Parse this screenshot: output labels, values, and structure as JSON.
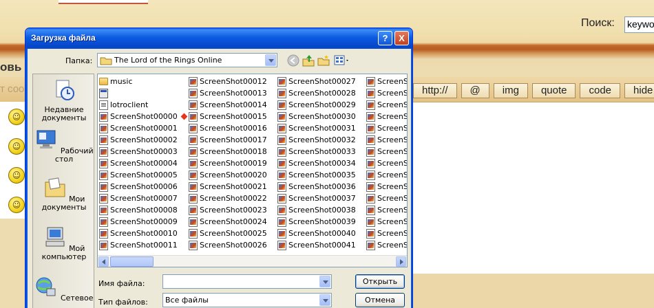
{
  "background": {
    "search_label": "Поиск:",
    "search_value": "keywo",
    "heading_fragment": "овь",
    "faded_text": "т соо",
    "bbcode_buttons": [
      "http://",
      "@",
      "img",
      "quote",
      "code",
      "hide"
    ],
    "smileys": [
      "smile-icon",
      "wink-icon",
      "happy-icon",
      "confused-icon"
    ]
  },
  "dialog": {
    "title": "Загрузка файла",
    "help_symbol": "?",
    "close_symbol": "X",
    "folder_label": "Папка:",
    "folder_value": "The Lord of the Rings Online",
    "places": [
      {
        "label": "Недавние документы",
        "icon": "recent-documents-icon"
      },
      {
        "label": "Рабочий стол",
        "icon": "desktop-icon"
      },
      {
        "label": "Мои документы",
        "icon": "my-documents-icon"
      },
      {
        "label": "Мой компьютер",
        "icon": "my-computer-icon"
      },
      {
        "label": "Сетевое",
        "icon": "network-icon"
      }
    ],
    "files": {
      "col1": [
        {
          "name": "music",
          "type": "folder"
        },
        {
          "name": "",
          "type": "app"
        },
        {
          "name": "lotroclient",
          "type": "doc"
        },
        {
          "name": "ScreenShot00000",
          "type": "img",
          "marker": true
        },
        {
          "name": "ScreenShot00001",
          "type": "img"
        },
        {
          "name": "ScreenShot00002",
          "type": "img"
        },
        {
          "name": "ScreenShot00003",
          "type": "img"
        },
        {
          "name": "ScreenShot00004",
          "type": "img"
        },
        {
          "name": "ScreenShot00005",
          "type": "img"
        },
        {
          "name": "ScreenShot00006",
          "type": "img"
        },
        {
          "name": "ScreenShot00007",
          "type": "img"
        },
        {
          "name": "ScreenShot00008",
          "type": "img"
        },
        {
          "name": "ScreenShot00009",
          "type": "img"
        },
        {
          "name": "ScreenShot00010",
          "type": "img"
        },
        {
          "name": "ScreenShot00011",
          "type": "img"
        }
      ],
      "col2": [
        "ScreenShot00012",
        "ScreenShot00013",
        "ScreenShot00014",
        "ScreenShot00015",
        "ScreenShot00016",
        "ScreenShot00017",
        "ScreenShot00018",
        "ScreenShot00019",
        "ScreenShot00020",
        "ScreenShot00021",
        "ScreenShot00022",
        "ScreenShot00023",
        "ScreenShot00024",
        "ScreenShot00025",
        "ScreenShot00026"
      ],
      "col3": [
        "ScreenShot00027",
        "ScreenShot00028",
        "ScreenShot00029",
        "ScreenShot00030",
        "ScreenShot00031",
        "ScreenShot00032",
        "ScreenShot00033",
        "ScreenShot00034",
        "ScreenShot00035",
        "ScreenShot00036",
        "ScreenShot00037",
        "ScreenShot00038",
        "ScreenShot00039",
        "ScreenShot00040",
        "ScreenShot00041"
      ],
      "col4": [
        "ScreenSh",
        "ScreenSh",
        "ScreenSh",
        "ScreenSh",
        "ScreenSh",
        "ScreenSh",
        "ScreenSh",
        "ScreenSh",
        "ScreenSh",
        "ScreenSh",
        "ScreenSh",
        "ScreenSh",
        "ScreenSh",
        "ScreenSh",
        "ScreenSh"
      ]
    },
    "filename_label": "Имя файла:",
    "filename_value": "",
    "filetype_label": "Тип файлов:",
    "filetype_value": "Все файлы",
    "open_button": "Открыть",
    "cancel_button": "Отмена"
  },
  "colors": {
    "titlebar": "#0a5fe6",
    "dialog_face": "#ece9d8",
    "page_background": "#f1e0ad",
    "page_stripe": "#b65d22"
  }
}
